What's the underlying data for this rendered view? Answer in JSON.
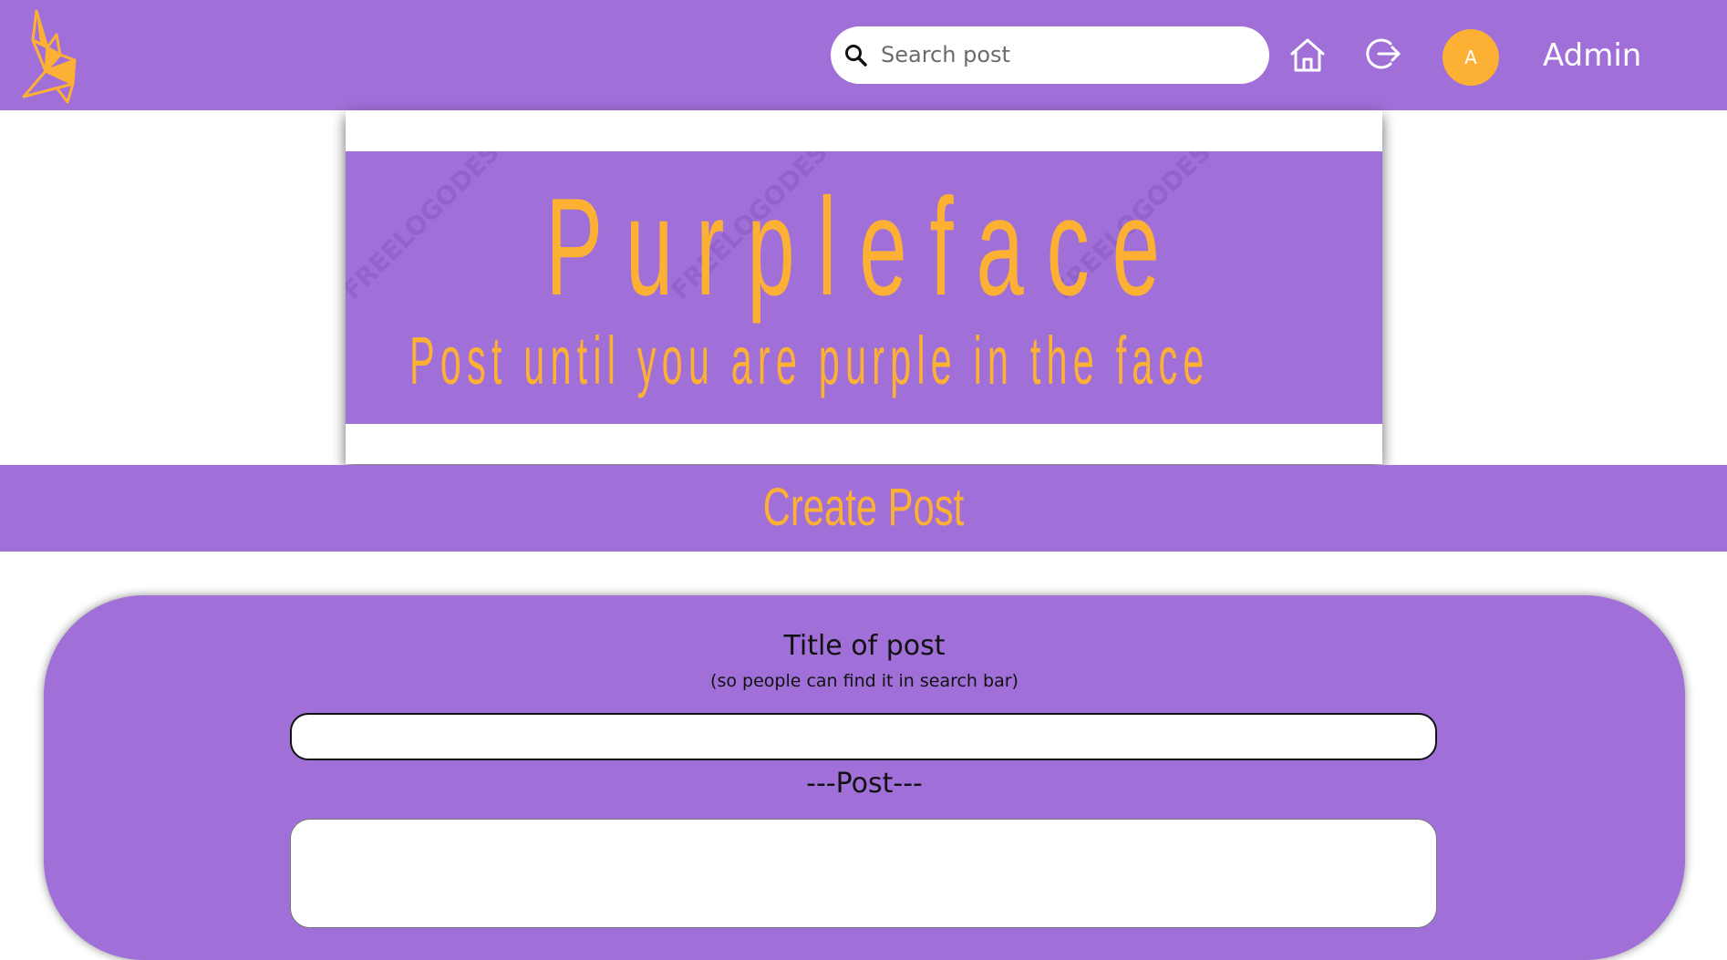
{
  "header": {
    "search_placeholder": "Search post",
    "avatar_initial": "A",
    "username": "Admin"
  },
  "banner": {
    "title": "Purpleface",
    "tagline": "Post until you are purple in the face",
    "watermark": "FREELOGODESIGN"
  },
  "section": {
    "title": "Create Post"
  },
  "form": {
    "title_label": "Title of post",
    "title_hint": "(so people can find it in search bar)",
    "title_value": "",
    "post_label": "---Post---",
    "post_value": ""
  },
  "colors": {
    "brand_purple": "#a06fd8",
    "brand_orange": "#fcb034",
    "text_dark": "#111111",
    "white": "#ffffff"
  },
  "icons": {
    "logo": "origami-bird-logo",
    "search": "search-icon",
    "home": "home-icon",
    "logout": "logout-icon"
  }
}
